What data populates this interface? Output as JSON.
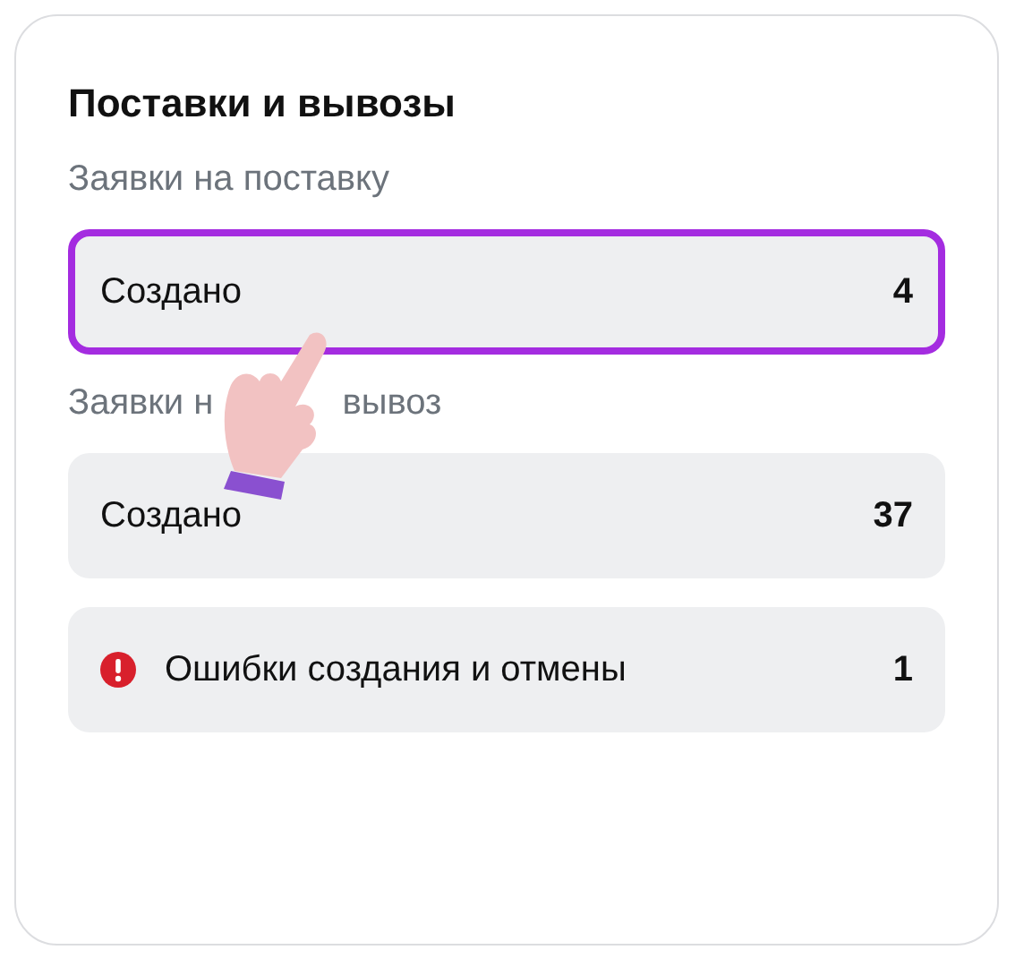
{
  "card": {
    "title": "Поставки и вывозы"
  },
  "sections": [
    {
      "label_parts": [
        "Заявки на поставку"
      ],
      "rows": [
        {
          "kind": "plain",
          "label": "Создано",
          "count": "4",
          "selected": true
        }
      ]
    },
    {
      "label_parts": [
        "Заявки н",
        "вывоз"
      ],
      "rows": [
        {
          "kind": "plain",
          "label": "Создано",
          "count": "37",
          "selected": false
        },
        {
          "kind": "error",
          "label": "Ошибки создания и отмены",
          "count": "1",
          "selected": false
        }
      ]
    }
  ]
}
